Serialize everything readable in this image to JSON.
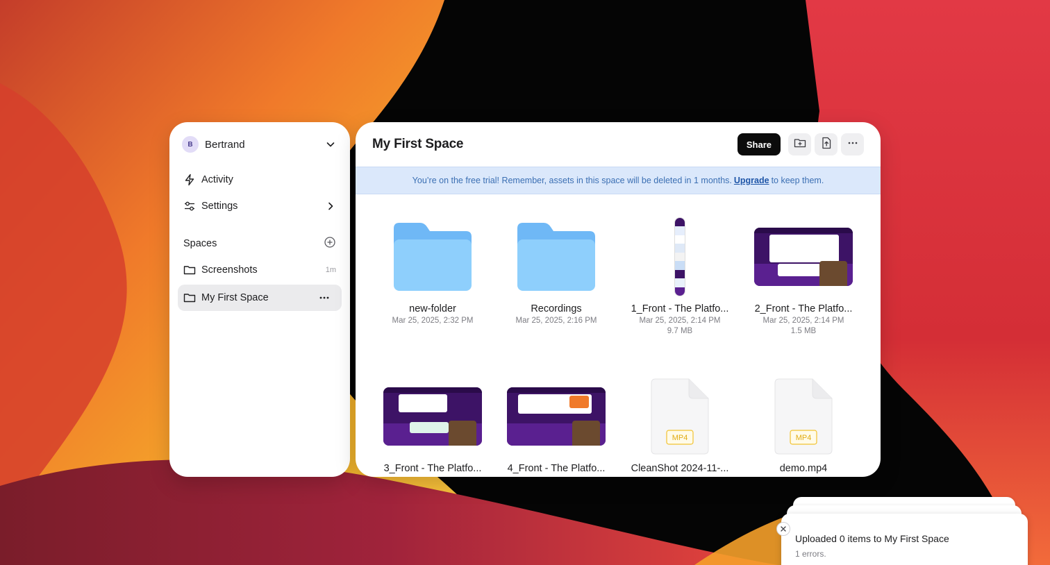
{
  "sidebar": {
    "account": {
      "initial": "B",
      "name": "Bertrand"
    },
    "nav": [
      {
        "label": "Activity",
        "icon": "lightning-icon"
      },
      {
        "label": "Settings",
        "icon": "sliders-icon"
      }
    ],
    "spaces_label": "Spaces",
    "spaces": [
      {
        "label": "Screenshots",
        "meta": "1m",
        "active": false
      },
      {
        "label": "My First Space",
        "meta": "",
        "active": true
      }
    ]
  },
  "main": {
    "title": "My First Space",
    "share_label": "Share",
    "banner": {
      "text_before": "You’re on the free trial! Remember, assets in this space will be deleted in 1 months.",
      "link": "Upgrade",
      "text_after": "to keep them."
    },
    "items": [
      {
        "name": "new-folder",
        "date": "Mar 25, 2025, 2:32 PM",
        "size": "",
        "kind": "folder"
      },
      {
        "name": "Recordings",
        "date": "Mar 25, 2025, 2:16 PM",
        "size": "",
        "kind": "folder"
      },
      {
        "name": "1_Front - The Platfo...",
        "date": "Mar 25, 2025, 2:14 PM",
        "size": "9.7 MB",
        "kind": "tall-image"
      },
      {
        "name": "2_Front - The Platfo...",
        "date": "Mar 25, 2025, 2:14 PM",
        "size": "1.5 MB",
        "kind": "screenshot"
      },
      {
        "name": "3_Front - The Platfo...",
        "date": "",
        "size": "",
        "kind": "screenshot"
      },
      {
        "name": "4_Front - The Platfo...",
        "date": "",
        "size": "",
        "kind": "screenshot"
      },
      {
        "name": "CleanShot 2024-11-...",
        "date": "",
        "size": "",
        "kind": "mp4",
        "badge": "MP4"
      },
      {
        "name": "demo.mp4",
        "date": "",
        "size": "",
        "kind": "mp4",
        "badge": "MP4"
      }
    ]
  },
  "toast": {
    "title": "Uploaded 0 items to My First Space",
    "subtitle": "1 errors."
  },
  "colors": {
    "accent_dark": "#0b0b0b",
    "banner_bg": "#dbe8fb",
    "banner_text": "#3b6fb3",
    "folder_blue": "#8ccdfb",
    "mp4_badge": "#f2c230",
    "thumb_purple": "#3d1366"
  }
}
